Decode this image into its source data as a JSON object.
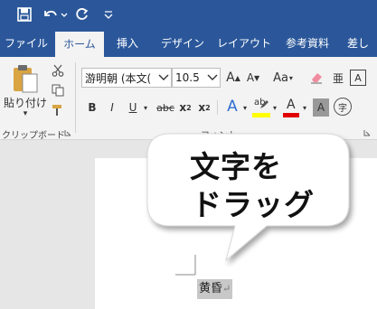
{
  "quick_access": {
    "icons": [
      "save-icon",
      "undo-icon",
      "redo-icon",
      "customize-toolbar-icon"
    ]
  },
  "tabs": [
    {
      "label": "ファイル"
    },
    {
      "label": "ホーム",
      "active": true
    },
    {
      "label": "挿入"
    },
    {
      "label": "デザイン"
    },
    {
      "label": "レイアウト"
    },
    {
      "label": "参考資料"
    },
    {
      "label": "差し"
    }
  ],
  "clipboard": {
    "paste_label": "貼り付け",
    "paste_arrow": "▾",
    "group_label": "クリップボード"
  },
  "font": {
    "font_name": "游明朝 (本文(",
    "font_size": "10.5",
    "grow_label": "A",
    "shrink_label": "A",
    "case_label": "Aa",
    "bold": "B",
    "italic": "I",
    "underline": "U",
    "strikethrough": "abc",
    "subscript": "x",
    "subscript_mark": "2",
    "superscript": "x",
    "superscript_mark": "2",
    "effects": "A",
    "highlight_text": "ab",
    "font_color": "A",
    "shade": "A",
    "encircle": "字",
    "phonetic": "亜",
    "border_char": "A",
    "group_label": "フォント",
    "highlight_color": "#ffff00",
    "font_color_value": "#e00000"
  },
  "callout": {
    "line1": "文字を",
    "line2": "ドラッグ"
  },
  "document": {
    "selected_text": "黄昏",
    "paragraph_mark": "↵"
  },
  "colors": {
    "brand": "#2b579a",
    "ribbon": "#f3f3f3",
    "selection": "#c8c8c8"
  }
}
